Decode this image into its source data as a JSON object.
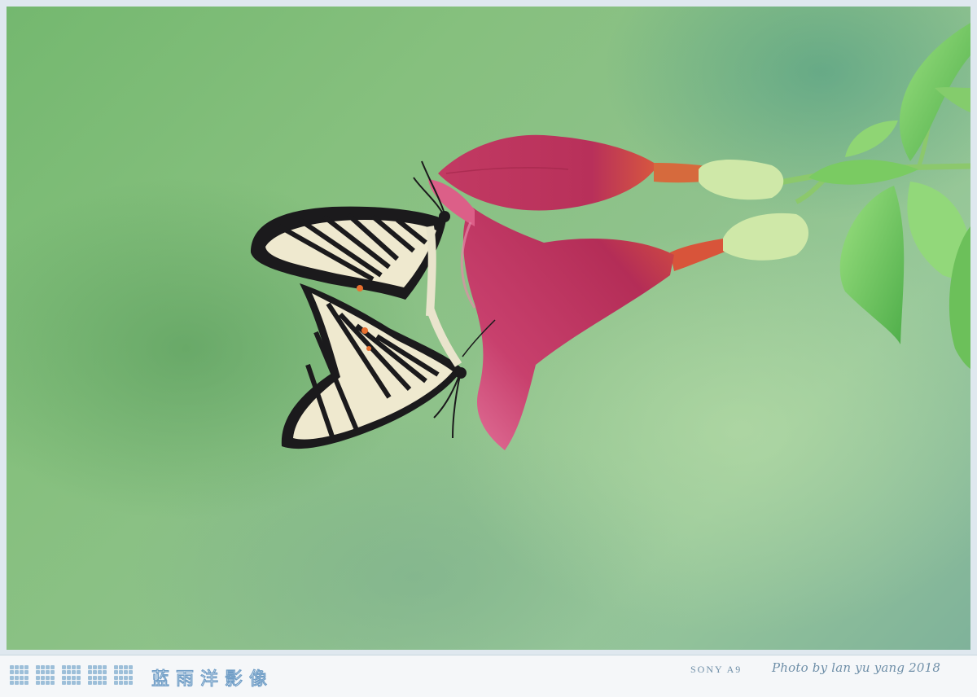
{
  "footer": {
    "studio_name": "蓝雨洋影像",
    "camera": "SONY A9",
    "credit": "Photo by lan yu yang 2018"
  },
  "colors": {
    "background_green": "#86c07e",
    "flower_magenta": "#c2345f",
    "leaf_green": "#76c863",
    "footer_text": "#6f8fa8",
    "footer_dots": "#9dbfd9"
  }
}
